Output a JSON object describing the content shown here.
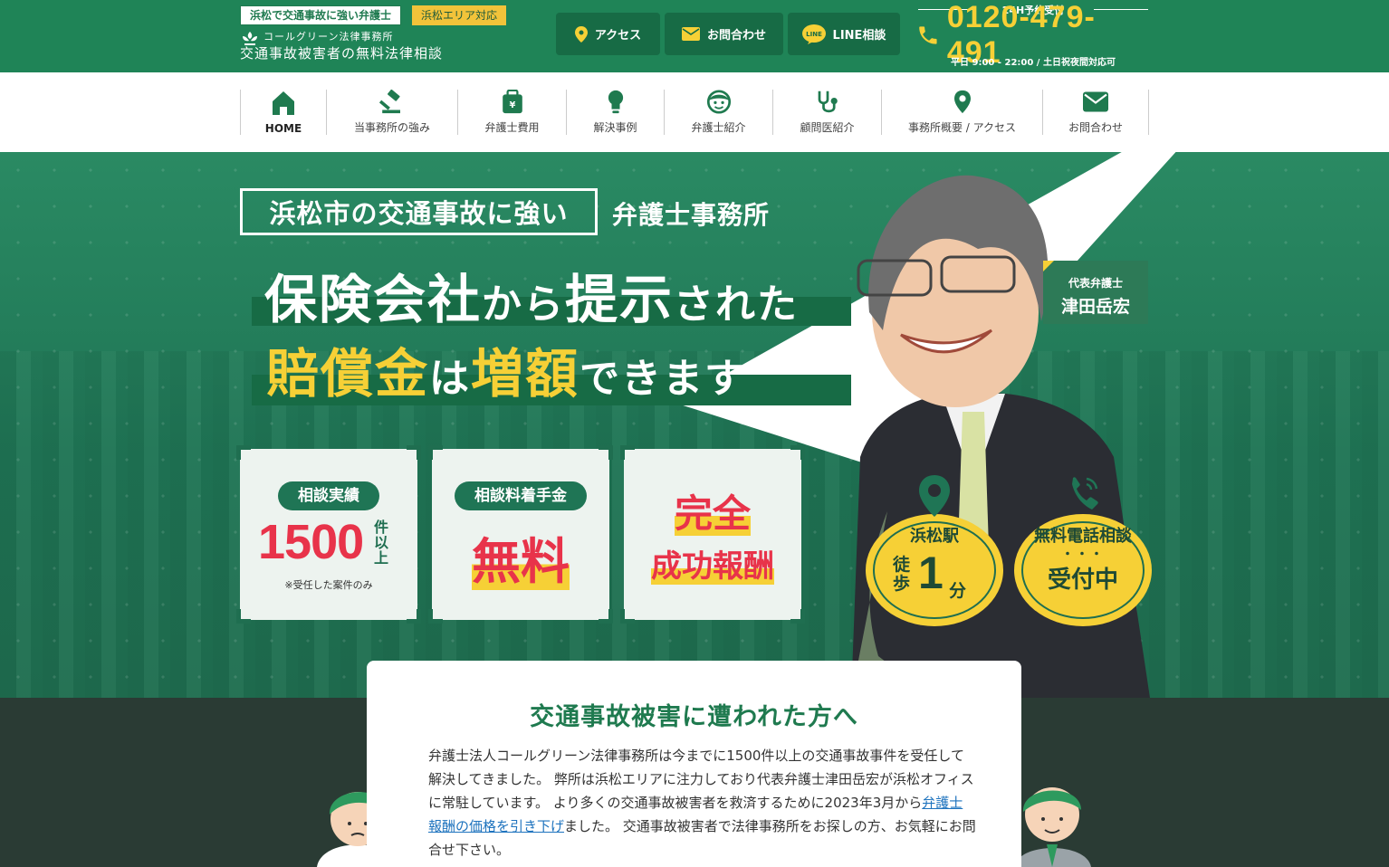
{
  "header": {
    "tag_primary": "浜松で交通事故に強い弁護士",
    "tag_area": "浜松エリア対応",
    "logo_firm": "コールグリーン法律事務所",
    "logo_title": "交通事故被害者の無料法律相談",
    "buttons": {
      "access": "アクセス",
      "contact": "お問合わせ",
      "line": "LINE相談"
    },
    "line_badge": "LINE",
    "phone_label": "24H予約受付",
    "phone_number": "0120-479-491",
    "phone_hours": "平日 9:00 - 22:00 / 土日祝夜間対応可"
  },
  "nav": [
    {
      "label": "HOME",
      "icon": "home-icon"
    },
    {
      "label": "当事務所の強み",
      "icon": "gavel-icon"
    },
    {
      "label": "弁護士費用",
      "icon": "wallet-icon"
    },
    {
      "label": "解決事例",
      "icon": "lightbulb-icon"
    },
    {
      "label": "弁護士紹介",
      "icon": "face-icon"
    },
    {
      "label": "顧問医紹介",
      "icon": "stethoscope-icon"
    },
    {
      "label": "事務所概要 / アクセス",
      "icon": "map-pin-icon"
    },
    {
      "label": "お問合わせ",
      "icon": "mail-icon"
    }
  ],
  "hero": {
    "subtitle_box": "浜松市の交通事故に強い",
    "subtitle_rest": "弁護士事務所",
    "headline1": {
      "a": "保険会社",
      "b": "から",
      "c": "提示",
      "d": "された"
    },
    "headline2": {
      "a": "賠償金",
      "b": "は",
      "c": "増額",
      "d": "できます"
    },
    "lawyer_role": "代表弁護士",
    "lawyer_name": "津田岳宏",
    "cards": {
      "c1_label": "相談実績",
      "c1_value": "1500",
      "c1_unit": "件以上",
      "c1_note": "※受任した案件のみ",
      "c2_label": "相談料着手金",
      "c2_value": "無料",
      "c3_line1": "完全",
      "c3_line2": "成功報酬"
    },
    "badges": {
      "b1_title": "浜松駅",
      "b1_walk": "徒歩",
      "b1_num": "1",
      "b1_unit": "分",
      "b2_title": "無料電話相談",
      "b2_dots": "・・・",
      "b2_status": "受付中"
    }
  },
  "intro": {
    "heading": "交通事故被害に遭われた方へ",
    "p1": "弁護士法人コールグリーン法律事務所は今までに1500件以上の交通事故事件を受任して解決してきました。 弊所は浜松エリアに注力しており代表弁護士津田岳宏が浜松オフィスに常駐しています。 より多くの交通事故被害者を救済するために2023年3月から",
    "link": "弁護士報酬の価格を引き下げ",
    "p2": "ました。 交通事故被害者で法律事務所をお探しの方、お気軽にお問合せ下さい。"
  },
  "colors": {
    "brand_green": "#1f8457",
    "accent_yellow": "#f6d036",
    "accent_red": "#e8334a"
  }
}
